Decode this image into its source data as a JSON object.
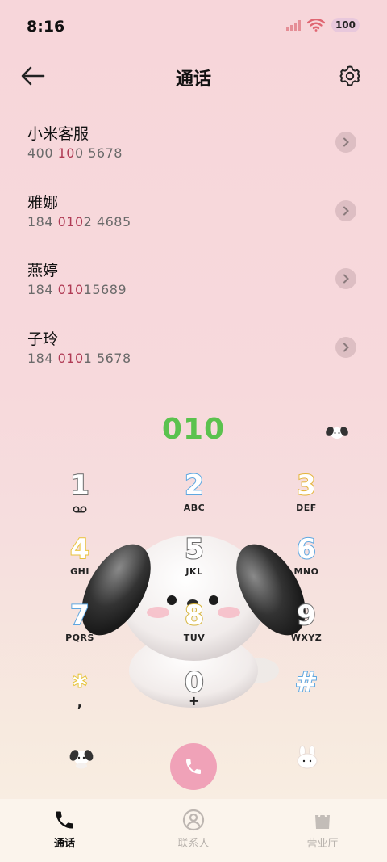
{
  "status": {
    "time": "8:16",
    "battery": "100"
  },
  "header": {
    "title": "通话"
  },
  "contacts": [
    {
      "name": "小米客服",
      "num_pre": "400 ",
      "num_hl": "10",
      "num_post": "0 5678"
    },
    {
      "name": "雅娜",
      "num_pre": "184 ",
      "num_hl": "010",
      "num_post": "2 4685"
    },
    {
      "name": "燕婷",
      "num_pre": "184 ",
      "num_hl": "010",
      "num_post": "15689"
    },
    {
      "name": "子玲",
      "num_pre": "184 ",
      "num_hl": "010",
      "num_post": "1 5678"
    }
  ],
  "dialed": "010",
  "keys": [
    {
      "digit": "1",
      "letters": ""
    },
    {
      "digit": "2",
      "letters": "ABC"
    },
    {
      "digit": "3",
      "letters": "DEF"
    },
    {
      "digit": "4",
      "letters": "GHI"
    },
    {
      "digit": "5",
      "letters": "JKL"
    },
    {
      "digit": "6",
      "letters": "MNO"
    },
    {
      "digit": "7",
      "letters": "PQRS"
    },
    {
      "digit": "8",
      "letters": "TUV"
    },
    {
      "digit": "9",
      "letters": "WXYZ"
    },
    {
      "digit": "*",
      "letters": ","
    },
    {
      "digit": "0",
      "letters": "+"
    },
    {
      "digit": "#",
      "letters": ""
    }
  ],
  "colors": {
    "dialed": "#5bc24e",
    "call": "#f0a2b8"
  },
  "tabs": [
    {
      "label": "通话",
      "icon": "phone-icon",
      "active": true
    },
    {
      "label": "联系人",
      "icon": "contact-icon",
      "active": false
    },
    {
      "label": "营业厅",
      "icon": "shop-bag-icon",
      "active": false
    }
  ]
}
